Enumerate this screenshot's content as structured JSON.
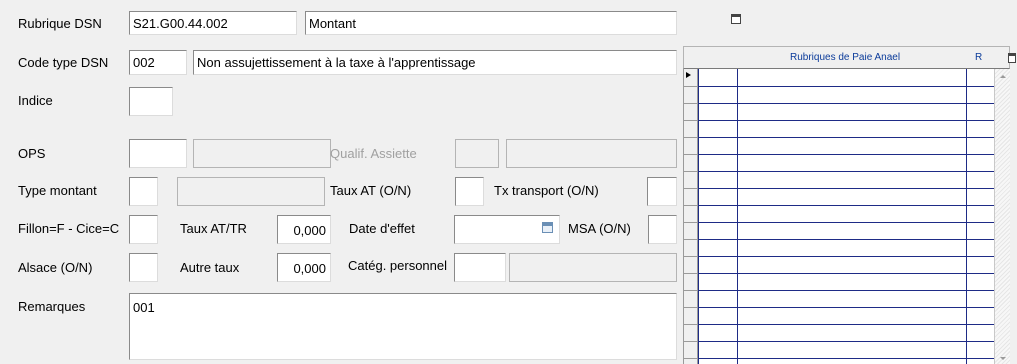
{
  "form": {
    "rubrique_dsn": {
      "label": "Rubrique DSN",
      "code": "S21.G00.44.002",
      "libelle": "Montant"
    },
    "code_type_dsn": {
      "label": "Code type DSN",
      "code": "002",
      "libelle": "Non assujettissement à la taxe à l'apprentissage"
    },
    "indice": {
      "label": "Indice",
      "value": ""
    },
    "ops": {
      "label": "OPS",
      "value": "",
      "value2": ""
    },
    "qualif_assiette": {
      "label": "Qualif. Assiette",
      "value": "",
      "value2": ""
    },
    "type_montant": {
      "label": "Type montant",
      "value": "",
      "value2": ""
    },
    "taux_at_on": {
      "label": "Taux AT (O/N)",
      "value": ""
    },
    "tx_transport": {
      "label": "Tx transport (O/N)",
      "value": ""
    },
    "fillon": {
      "label": "Fillon=F - Cice=C",
      "value": ""
    },
    "taux_at_tr": {
      "label": "Taux AT/TR",
      "value": "0,000"
    },
    "date_effet": {
      "label": "Date d'effet",
      "value": ""
    },
    "msa": {
      "label": "MSA (O/N)",
      "value": ""
    },
    "alsace": {
      "label": "Alsace (O/N)",
      "value": ""
    },
    "autre_taux": {
      "label": "Autre taux",
      "value": "0,000"
    },
    "categ_personnel": {
      "label": "Catég. personnel",
      "value": "",
      "value2": ""
    },
    "remarques": {
      "label": "Remarques",
      "value": "001"
    }
  },
  "grid": {
    "columns": [
      "",
      "Rubriques de Paie Anael",
      "R"
    ],
    "row_count": 17
  },
  "icons": {
    "delete_top": "trash-icon",
    "delete_grid": "trash-icon",
    "date_picker": "calendar-icon",
    "current_row": "row-pointer-icon"
  }
}
